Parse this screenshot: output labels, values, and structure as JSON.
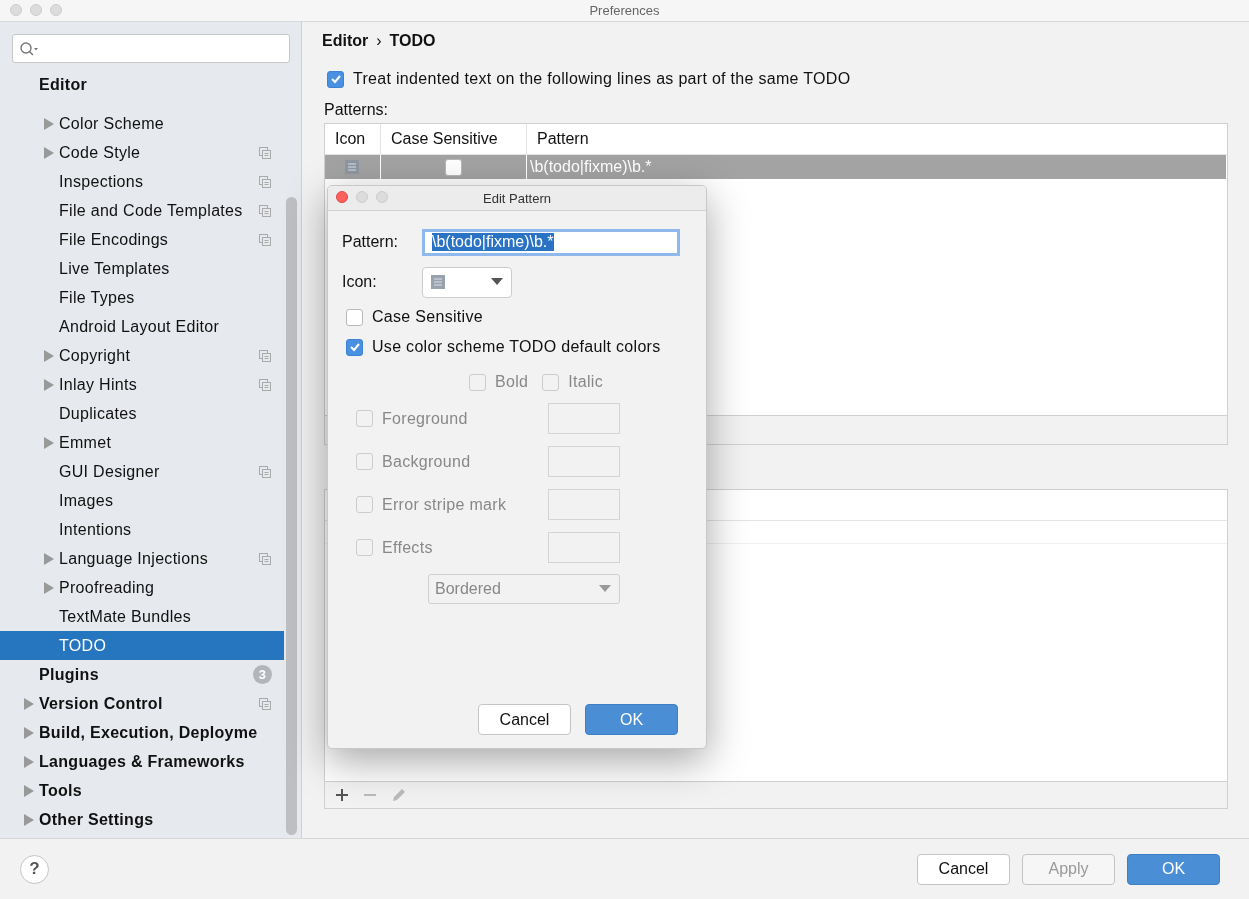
{
  "window": {
    "title": "Preferences"
  },
  "sidebar": {
    "items": [
      {
        "label": "Editor",
        "expandable": false,
        "project_scope": false,
        "selected": false,
        "children": [
          {
            "label": "Color Scheme",
            "expandable": true,
            "project_scope": false,
            "selected": false
          },
          {
            "label": "Code Style",
            "expandable": true,
            "project_scope": true,
            "selected": false
          },
          {
            "label": "Inspections",
            "expandable": false,
            "project_scope": true,
            "selected": false
          },
          {
            "label": "File and Code Templates",
            "expandable": false,
            "project_scope": true,
            "selected": false
          },
          {
            "label": "File Encodings",
            "expandable": false,
            "project_scope": true,
            "selected": false
          },
          {
            "label": "Live Templates",
            "expandable": false,
            "project_scope": false,
            "selected": false
          },
          {
            "label": "File Types",
            "expandable": false,
            "project_scope": false,
            "selected": false
          },
          {
            "label": "Android Layout Editor",
            "expandable": false,
            "project_scope": false,
            "selected": false
          },
          {
            "label": "Copyright",
            "expandable": true,
            "project_scope": true,
            "selected": false
          },
          {
            "label": "Inlay Hints",
            "expandable": true,
            "project_scope": true,
            "selected": false
          },
          {
            "label": "Duplicates",
            "expandable": false,
            "project_scope": false,
            "selected": false
          },
          {
            "label": "Emmet",
            "expandable": true,
            "project_scope": false,
            "selected": false
          },
          {
            "label": "GUI Designer",
            "expandable": false,
            "project_scope": true,
            "selected": false
          },
          {
            "label": "Images",
            "expandable": false,
            "project_scope": false,
            "selected": false
          },
          {
            "label": "Intentions",
            "expandable": false,
            "project_scope": false,
            "selected": false
          },
          {
            "label": "Language Injections",
            "expandable": true,
            "project_scope": true,
            "selected": false
          },
          {
            "label": "Proofreading",
            "expandable": true,
            "project_scope": false,
            "selected": false
          },
          {
            "label": "TextMate Bundles",
            "expandable": false,
            "project_scope": false,
            "selected": false
          },
          {
            "label": "TODO",
            "expandable": false,
            "project_scope": false,
            "selected": true
          }
        ]
      },
      {
        "label": "Plugins",
        "badge": "3",
        "expandable": false,
        "project_scope": false,
        "selected": false
      },
      {
        "label": "Version Control",
        "expandable": true,
        "project_scope": true,
        "selected": false
      },
      {
        "label": "Build, Execution, Deployme",
        "expandable": true,
        "project_scope": false,
        "selected": false
      },
      {
        "label": "Languages & Frameworks",
        "expandable": true,
        "project_scope": false,
        "selected": false
      },
      {
        "label": "Tools",
        "expandable": true,
        "project_scope": false,
        "selected": false
      },
      {
        "label": "Other Settings",
        "expandable": true,
        "project_scope": false,
        "selected": false
      }
    ]
  },
  "breadcrumb": [
    "Editor",
    "›",
    "TODO"
  ],
  "indent_option": {
    "label": "Treat indented text on the following lines as part of the same TODO",
    "checked": true
  },
  "patterns": {
    "label": "Patterns:",
    "columns": [
      "Icon",
      "Case Sensitive",
      "Pattern"
    ],
    "rows": [
      {
        "case_sensitive": false,
        "pattern": "\\b(todo|fixme)\\b.*",
        "selected": true
      }
    ]
  },
  "filters": {
    "toolbar": [
      {
        "kind": "add",
        "disabled": false
      },
      {
        "kind": "remove",
        "disabled": true
      },
      {
        "kind": "edit",
        "disabled": true
      }
    ]
  },
  "help": "?",
  "buttons": [
    {
      "label": "Cancel",
      "kind": "normal",
      "disabled": false
    },
    {
      "label": "Apply",
      "kind": "normal",
      "disabled": true
    },
    {
      "label": "OK",
      "kind": "default",
      "disabled": false
    }
  ],
  "dialog": {
    "title": "Edit Pattern",
    "pattern_label": "Pattern:",
    "pattern_value": "\\b(todo|fixme)\\b.*",
    "icon_label": "Icon:",
    "case_sensitive": {
      "label": "Case Sensitive",
      "checked": false
    },
    "use_default": {
      "label": "Use color scheme TODO default colors",
      "checked": true
    },
    "styles": [
      {
        "label": "Bold",
        "checked": false
      },
      {
        "label": "Italic",
        "checked": false
      }
    ],
    "colors": [
      {
        "label": "Foreground",
        "checked": false
      },
      {
        "label": "Background",
        "checked": false
      },
      {
        "label": "Error stripe mark",
        "checked": false
      },
      {
        "label": "Effects",
        "checked": false
      }
    ],
    "effect_type": "Bordered",
    "buttons": [
      {
        "label": "Cancel",
        "kind": "normal"
      },
      {
        "label": "OK",
        "kind": "default"
      }
    ]
  }
}
